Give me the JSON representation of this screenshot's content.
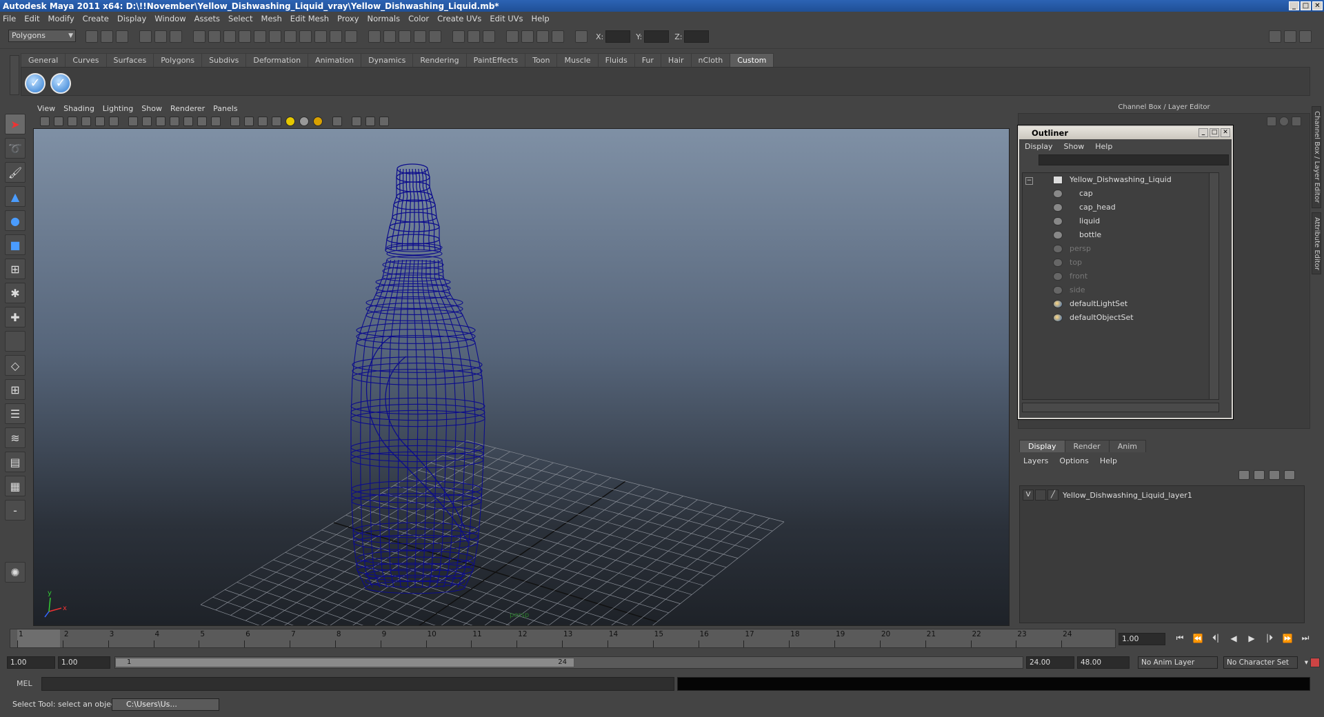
{
  "window": {
    "title": "Autodesk Maya 2011 x64: D:\\!!November\\Yellow_Dishwashing_Liquid_vray\\Yellow_Dishwashing_Liquid.mb*",
    "minimize": "_",
    "maximize": "□",
    "close": "✕"
  },
  "menubar": [
    "File",
    "Edit",
    "Modify",
    "Create",
    "Display",
    "Window",
    "Assets",
    "Select",
    "Mesh",
    "Edit Mesh",
    "Proxy",
    "Normals",
    "Color",
    "Create UVs",
    "Edit UVs",
    "Help"
  ],
  "statusline": {
    "mode": "Polygons",
    "x_label": "X:",
    "y_label": "Y:",
    "z_label": "Z:"
  },
  "shelf": {
    "tabs": [
      "General",
      "Curves",
      "Surfaces",
      "Polygons",
      "Subdivs",
      "Deformation",
      "Animation",
      "Dynamics",
      "Rendering",
      "PaintEffects",
      "Toon",
      "Muscle",
      "Fluids",
      "Fur",
      "Hair",
      "nCloth",
      "Custom"
    ],
    "active_tab": "Custom"
  },
  "viewport": {
    "menu": [
      "View",
      "Shading",
      "Lighting",
      "Show",
      "Renderer",
      "Panels"
    ],
    "camera_label": "persp",
    "axis_x": "x",
    "axis_y": "y",
    "wire_color": "#0c0c8c"
  },
  "channel_box": {
    "header": "Channel Box / Layer Editor"
  },
  "side_tabs": [
    "Channel Box / Layer Editor",
    "Attribute Editor"
  ],
  "outliner": {
    "title": "Outliner",
    "menu": [
      "Display",
      "Show",
      "Help"
    ],
    "items": [
      {
        "label": "Yellow_Dishwashing_Liquid",
        "level": 0,
        "dim": false,
        "kind": "group"
      },
      {
        "label": "cap",
        "level": 1,
        "dim": false,
        "kind": "mesh"
      },
      {
        "label": "cap_head",
        "level": 1,
        "dim": false,
        "kind": "mesh"
      },
      {
        "label": "liquid",
        "level": 1,
        "dim": false,
        "kind": "mesh"
      },
      {
        "label": "bottle",
        "level": 1,
        "dim": false,
        "kind": "mesh"
      },
      {
        "label": "persp",
        "level": 0,
        "dim": true,
        "kind": "camera"
      },
      {
        "label": "top",
        "level": 0,
        "dim": true,
        "kind": "camera"
      },
      {
        "label": "front",
        "level": 0,
        "dim": true,
        "kind": "camera"
      },
      {
        "label": "side",
        "level": 0,
        "dim": true,
        "kind": "camera"
      },
      {
        "label": "defaultLightSet",
        "level": 0,
        "dim": false,
        "kind": "set"
      },
      {
        "label": "defaultObjectSet",
        "level": 0,
        "dim": false,
        "kind": "set"
      }
    ]
  },
  "layer_editor": {
    "tabs": [
      "Display",
      "Render",
      "Anim"
    ],
    "active_tab": "Display",
    "menu": [
      "Layers",
      "Options",
      "Help"
    ],
    "layers": [
      {
        "visible": "V",
        "name": "Yellow_Dishwashing_Liquid_layer1"
      }
    ]
  },
  "timeline": {
    "start": 1,
    "end": 24,
    "current": 1,
    "current_frame_field": "1.00",
    "ticks": [
      "1",
      "2",
      "3",
      "4",
      "5",
      "6",
      "7",
      "8",
      "9",
      "10",
      "11",
      "12",
      "13",
      "14",
      "15",
      "16",
      "17",
      "18",
      "19",
      "20",
      "21",
      "22",
      "23",
      "24"
    ]
  },
  "playback": [
    "⏮",
    "⏪",
    "⏴|",
    "◀",
    "▶",
    "|⏵",
    "⏩",
    "⏭"
  ],
  "range": {
    "start_time": "1.00",
    "playback_start": "1.00",
    "handle_start": "1",
    "handle_end": "24",
    "playback_end": "24.00",
    "end_time": "48.00",
    "anim_layer": "No Anim Layer",
    "character_set": "No Character Set"
  },
  "command_line": {
    "label": "MEL"
  },
  "help_line": {
    "text": "Select Tool: select an object"
  },
  "taskbar": {
    "label": "C:\\Users\\Us..."
  }
}
